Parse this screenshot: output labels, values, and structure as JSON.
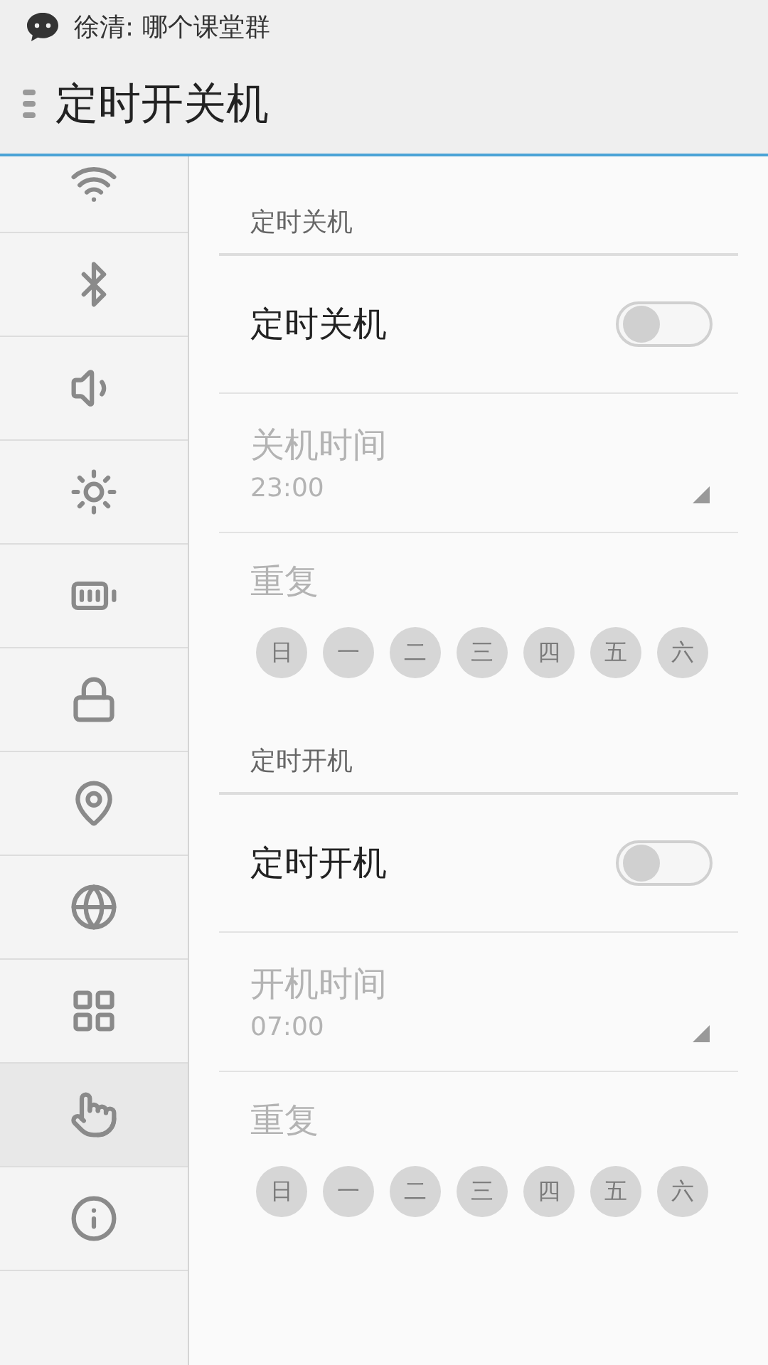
{
  "status_bar": {
    "notification": "徐清: 哪个课堂群"
  },
  "title_bar": {
    "title": "定时开关机"
  },
  "sidebar": {
    "items": [
      {
        "kind": "wifi",
        "selected": false
      },
      {
        "kind": "bluetooth",
        "selected": false
      },
      {
        "kind": "sound",
        "selected": false
      },
      {
        "kind": "brightness",
        "selected": false
      },
      {
        "kind": "battery",
        "selected": false
      },
      {
        "kind": "lock",
        "selected": false
      },
      {
        "kind": "location",
        "selected": false
      },
      {
        "kind": "globe",
        "selected": false
      },
      {
        "kind": "apps",
        "selected": false
      },
      {
        "kind": "gesture",
        "selected": true
      },
      {
        "kind": "info",
        "selected": false
      }
    ]
  },
  "sections": [
    {
      "header": "定时关机",
      "switch": {
        "label": "定时关机",
        "on": false
      },
      "time": {
        "label": "关机时间",
        "value": "23:00",
        "disabled": true
      },
      "repeat": {
        "label": "重复",
        "days": [
          {
            "label": "日",
            "selected": false
          },
          {
            "label": "一",
            "selected": false
          },
          {
            "label": "二",
            "selected": false
          },
          {
            "label": "三",
            "selected": false
          },
          {
            "label": "四",
            "selected": false
          },
          {
            "label": "五",
            "selected": false
          },
          {
            "label": "六",
            "selected": false
          }
        ]
      }
    },
    {
      "header": "定时开机",
      "switch": {
        "label": "定时开机",
        "on": false
      },
      "time": {
        "label": "开机时间",
        "value": "07:00",
        "disabled": true
      },
      "repeat": {
        "label": "重复",
        "days": [
          {
            "label": "日",
            "selected": false
          },
          {
            "label": "一",
            "selected": false
          },
          {
            "label": "二",
            "selected": false
          },
          {
            "label": "三",
            "selected": false
          },
          {
            "label": "四",
            "selected": false
          },
          {
            "label": "五",
            "selected": false
          },
          {
            "label": "六",
            "selected": false
          }
        ]
      }
    }
  ]
}
